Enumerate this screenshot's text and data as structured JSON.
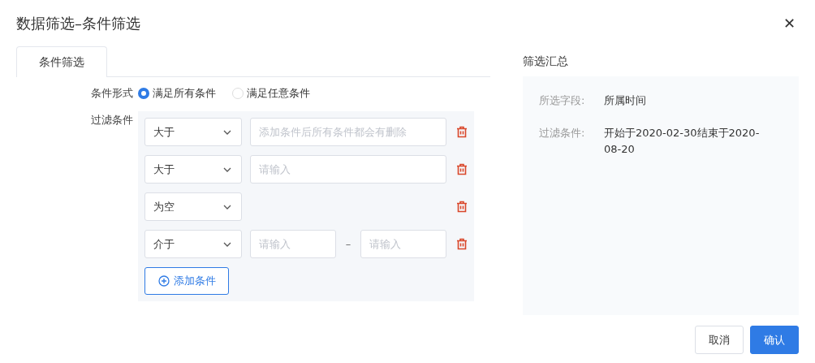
{
  "window": {
    "title": "数据筛选–条件筛选",
    "close": "✕"
  },
  "tabs": [
    {
      "label": "条件筛选",
      "selected": true
    }
  ],
  "form": {
    "mode_label": "条件形式",
    "modes": [
      {
        "label": "满足所有条件",
        "selected": true
      },
      {
        "label": "满足任意条件",
        "selected": false
      }
    ],
    "filter_label": "过滤条件",
    "conditions": [
      {
        "operator": "大于",
        "kind": "single",
        "placeholder": "添加条件后所有条件都会有删除"
      },
      {
        "operator": "大于",
        "kind": "single",
        "placeholder": "请输入"
      },
      {
        "operator": "为空",
        "kind": "none"
      },
      {
        "operator": "介于",
        "kind": "range",
        "placeholder": "请输入",
        "placeholder_end": "请输入",
        "separator": "–"
      }
    ],
    "add_button": "添加条件"
  },
  "summary": {
    "title": "筛选汇总",
    "rows": [
      {
        "label": "所选字段:",
        "value": "所属时间"
      },
      {
        "label": "过滤条件:",
        "value": "开始于2020-02-30结束于2020-08-20"
      }
    ]
  },
  "buttons": [
    {
      "label": "取消",
      "kind": "secondary"
    },
    {
      "label": "确认",
      "kind": "primary"
    }
  ]
}
